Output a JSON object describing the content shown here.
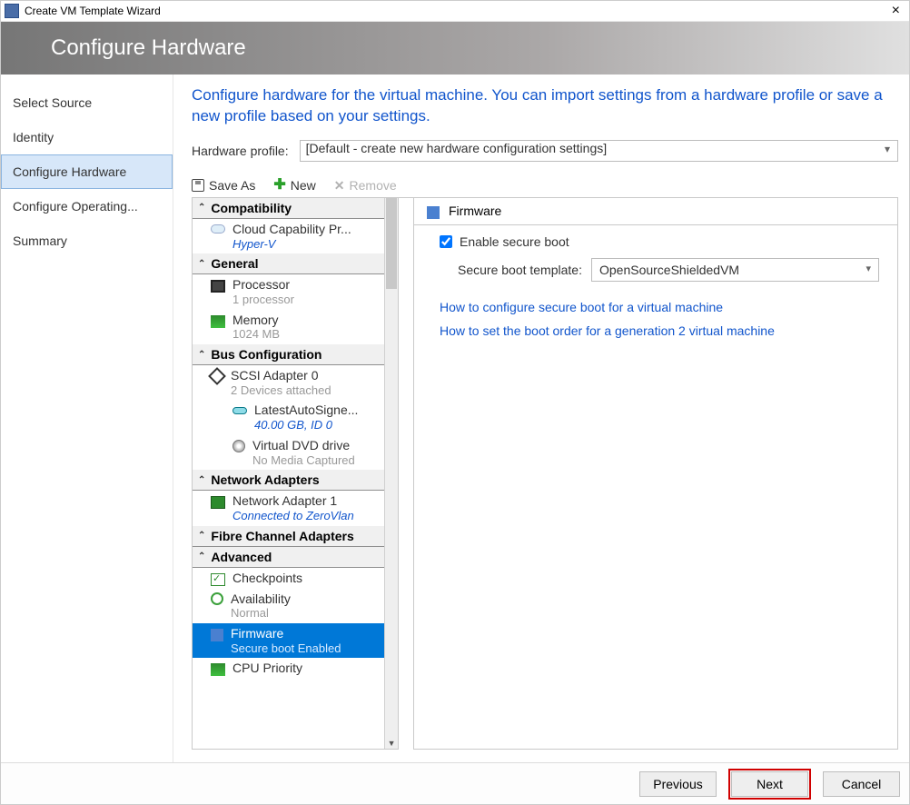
{
  "window": {
    "title": "Create VM Template Wizard"
  },
  "banner": {
    "heading": "Configure Hardware"
  },
  "side_nav": {
    "items": [
      "Select Source",
      "Identity",
      "Configure Hardware",
      "Configure Operating...",
      "Summary"
    ],
    "selected_index": 2
  },
  "main": {
    "instructions": "Configure hardware for the virtual machine. You can import settings from a hardware profile or save a new profile based on your settings.",
    "profile_label": "Hardware profile:",
    "profile_value": "[Default - create new hardware configuration settings]"
  },
  "toolbar": {
    "save_as": "Save As",
    "new_label": "New",
    "remove_label": "Remove"
  },
  "tree": {
    "groups": [
      {
        "name": "Compatibility",
        "items": [
          {
            "label": "Cloud Capability Pr...",
            "sub": "Hyper-V",
            "subStyle": "link",
            "icon": "cloud"
          }
        ]
      },
      {
        "name": "General",
        "items": [
          {
            "label": "Processor",
            "sub": "1 processor",
            "icon": "cpu"
          },
          {
            "label": "Memory",
            "sub": "1024 MB",
            "icon": "mem"
          }
        ]
      },
      {
        "name": "Bus Configuration",
        "items": [
          {
            "label": "SCSI Adapter 0",
            "sub": "2 Devices attached",
            "icon": "scsi"
          },
          {
            "label": "LatestAutoSigne...",
            "sub": "40.00 GB, ID 0",
            "subStyle": "link",
            "icon": "disk",
            "indent": 2
          },
          {
            "label": "Virtual DVD drive",
            "sub": "No Media Captured",
            "icon": "dvd",
            "indent": 2
          }
        ]
      },
      {
        "name": "Network Adapters",
        "items": [
          {
            "label": "Network Adapter 1",
            "sub": "Connected to ZeroVlan",
            "subStyle": "link",
            "icon": "net"
          }
        ]
      },
      {
        "name": "Fibre Channel Adapters",
        "items": []
      },
      {
        "name": "Advanced",
        "items": [
          {
            "label": "Checkpoints",
            "sub": "",
            "icon": "check"
          },
          {
            "label": "Availability",
            "sub": "Normal",
            "icon": "avail"
          },
          {
            "label": "Firmware",
            "sub": "Secure boot Enabled",
            "icon": "fw",
            "selected": true
          },
          {
            "label": "CPU Priority",
            "sub": "",
            "icon": "mem"
          }
        ]
      }
    ]
  },
  "firmware": {
    "title": "Firmware",
    "enable_label": "Enable secure boot",
    "enable_checked": true,
    "template_label": "Secure boot template:",
    "template_value": "OpenSourceShieldedVM",
    "help1": "How to configure secure boot for a virtual machine",
    "help2": "How to set the boot order for a generation 2 virtual machine"
  },
  "footer": {
    "previous": "Previous",
    "next": "Next",
    "cancel": "Cancel"
  }
}
